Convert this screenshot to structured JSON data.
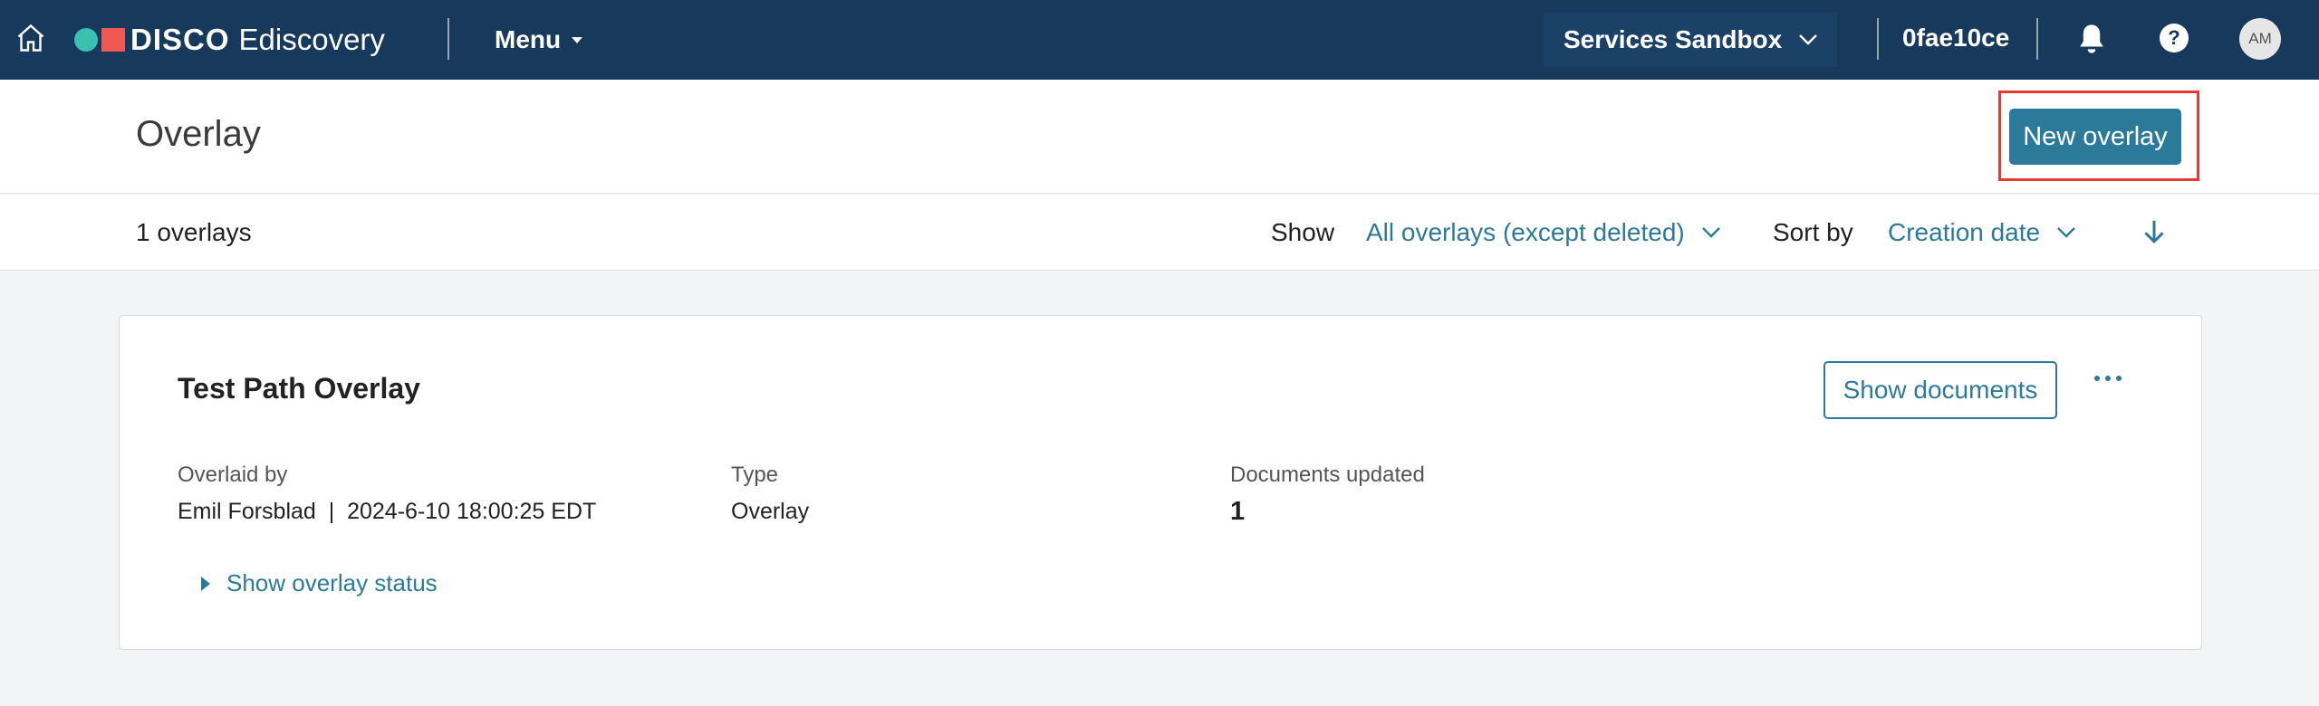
{
  "topbar": {
    "brand": "DISCO",
    "product": "Ediscovery",
    "menu_label": "Menu",
    "workspace_selector": "Services Sandbox",
    "workspace_id": "0fae10ce",
    "user_initials": "AM",
    "help_glyph": "?",
    "colors": {
      "bar": "#173a5c",
      "logo_dot": "#3bbfb0",
      "logo_square": "#ee5a52"
    }
  },
  "header": {
    "title": "Overlay",
    "new_button": "New overlay"
  },
  "toolbar": {
    "count": "1 overlays",
    "show_label": "Show",
    "show_value": "All overlays (except deleted)",
    "sort_label": "Sort by",
    "sort_value": "Creation date"
  },
  "overlays": [
    {
      "title": "Test Path Overlay",
      "show_documents": "Show documents",
      "overlaid_by_label": "Overlaid by",
      "overlaid_by_value": "Emil Forsblad  |  2024-6-10 18:00:25 EDT",
      "type_label": "Type",
      "type_value": "Overlay",
      "docs_updated_label": "Documents updated",
      "docs_updated_value": "1",
      "status_toggle": "Show overlay status"
    }
  ],
  "accent_color": "#2c7a9a",
  "highlight_color": "#e03c31"
}
